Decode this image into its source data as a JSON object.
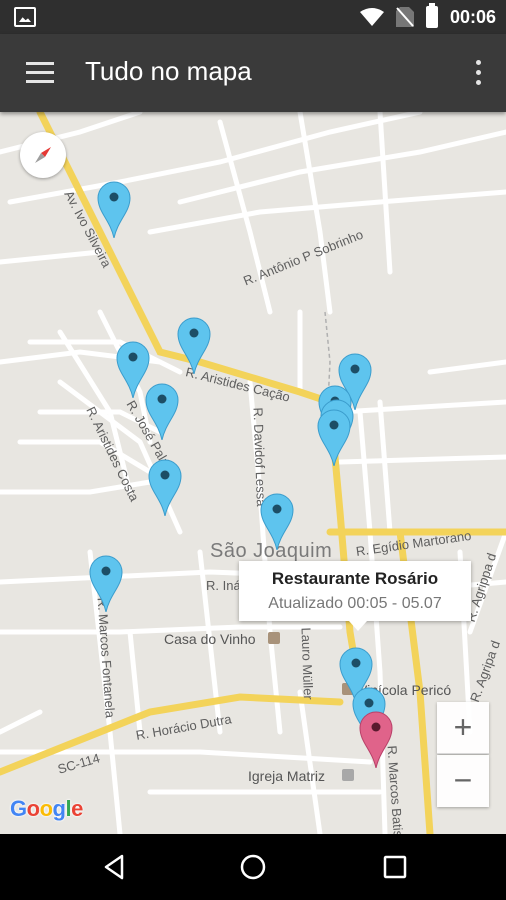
{
  "status_bar": {
    "time": "00:06"
  },
  "app_bar": {
    "title": "Tudo no mapa"
  },
  "map": {
    "streets": {
      "av_ivo_silveira": "Av. Ivo Silveira",
      "antonio_p_sobrinho": "R. Antônio P Sobrinho",
      "aristides_cacao": "R. Aristides Cação",
      "jose_palma": "R. José Palma",
      "aristides_costa": "R. Aristides Costa",
      "davidof_lessa": "R. Davidof Lessa",
      "egidio_martorano": "R. Egídio Martorano",
      "ina": "R. Iná",
      "marcos_fontanela": "R. Marcos Fontanela",
      "lauro_muller": "Lauro Müller",
      "horacio_dutra": "R. Horácio Dutra",
      "sc_114": "SC-114",
      "agrippa": "R. Agrippa d",
      "agripa": "R. Agripa d",
      "marcos_batista": "R. Marcos Batis"
    },
    "places": {
      "city": "São Joaquim",
      "casa_do_vinho": "Casa do Vinho",
      "vinicola_perico": "Vinícola Pericó",
      "igreja_matriz": "Igreja Matriz"
    },
    "info_window": {
      "title": "Restaurante Rosário",
      "snippet": "Atualizado 00:05 - 05.07"
    },
    "zoom_in_label": "+",
    "zoom_out_label": "−",
    "google_logo": {
      "letters": [
        "G",
        "o",
        "o",
        "g",
        "l",
        "e"
      ]
    },
    "marker_colors": {
      "default": "#5ec4ee",
      "selected": "#e0638a"
    },
    "road_colors": {
      "major": "#f3d35a",
      "minor": "#ffffff",
      "background": "#e8e6e1"
    }
  }
}
